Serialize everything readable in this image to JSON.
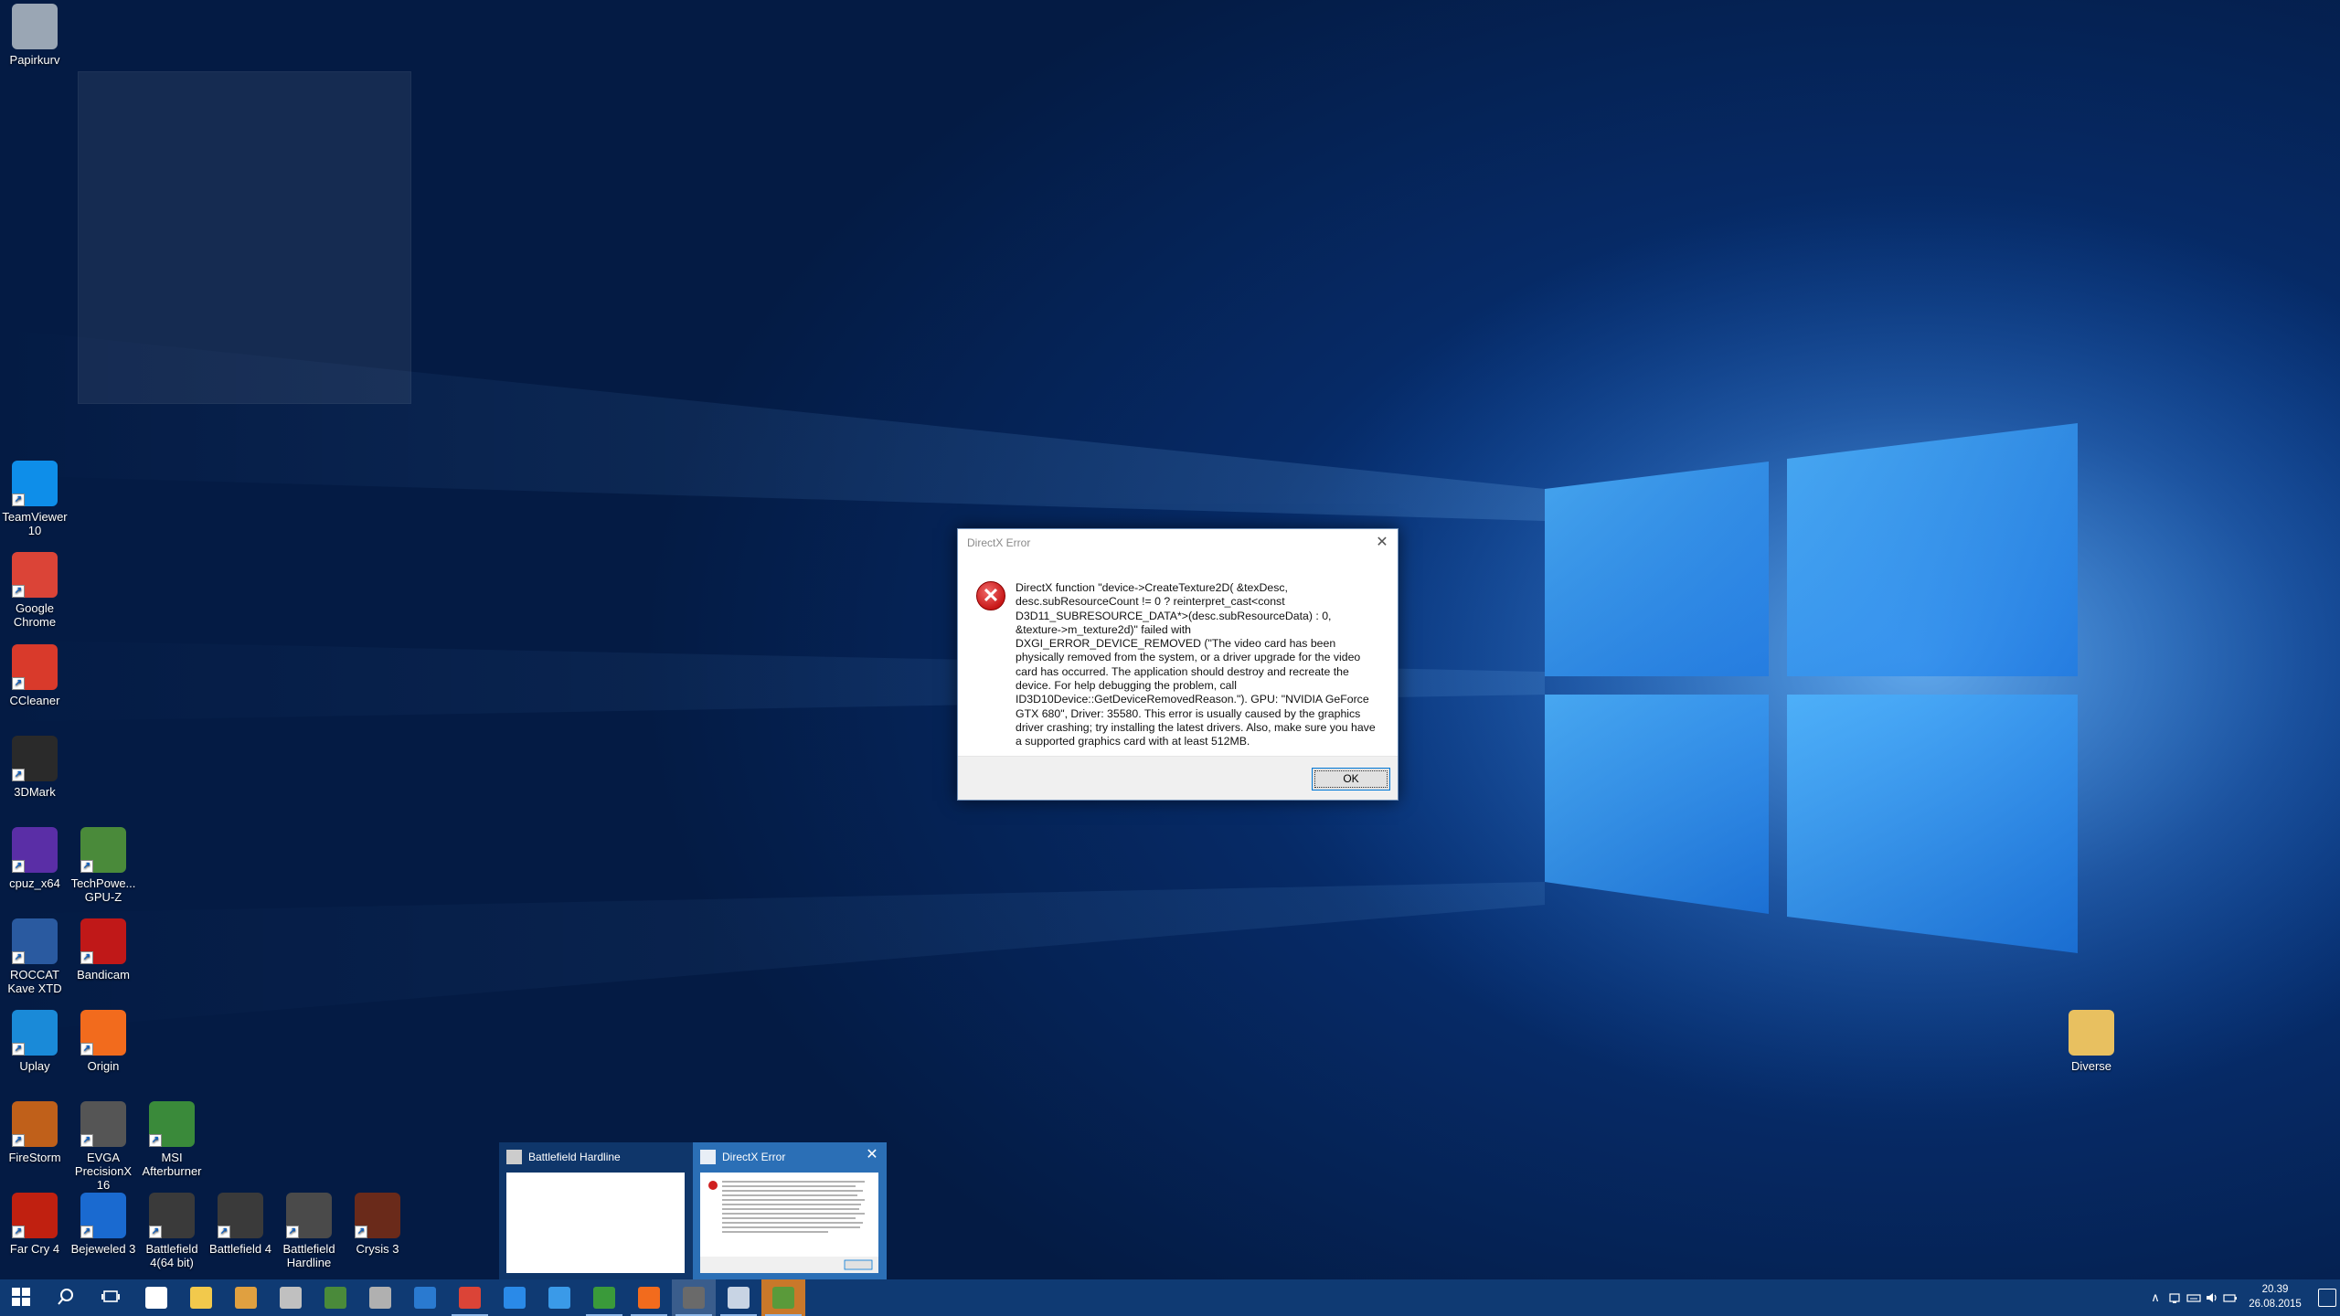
{
  "desktop_icons": [
    {
      "id": "recycle",
      "label": "Papirkurv",
      "icon": "recycle-bin-icon",
      "color": "#9aa6b4"
    },
    {
      "id": "teamviewer",
      "label": "TeamViewer 10",
      "icon": "teamviewer-icon",
      "color": "#0e8ee9"
    },
    {
      "id": "chrome",
      "label": "Google Chrome",
      "icon": "chrome-icon",
      "color": "#db4437"
    },
    {
      "id": "ccleaner",
      "label": "CCleaner",
      "icon": "ccleaner-icon",
      "color": "#d93a2b"
    },
    {
      "id": "3dmark",
      "label": "3DMark",
      "icon": "3dmark-icon",
      "color": "#2a2a2a"
    },
    {
      "id": "cpuz",
      "label": "cpuz_x64",
      "icon": "cpuz-icon",
      "color": "#5a2ea6"
    },
    {
      "id": "gpuz",
      "label": "TechPowe... GPU-Z",
      "icon": "gpuz-icon",
      "color": "#4a8a3a"
    },
    {
      "id": "roccat",
      "label": "ROCCAT Kave XTD",
      "icon": "roccat-icon",
      "color": "#2a5aa0"
    },
    {
      "id": "bandicam",
      "label": "Bandicam",
      "icon": "bandicam-icon",
      "color": "#c01818"
    },
    {
      "id": "uplay",
      "label": "Uplay",
      "icon": "uplay-icon",
      "color": "#1a8ad8"
    },
    {
      "id": "origin",
      "label": "Origin",
      "icon": "origin-icon",
      "color": "#f26b1d"
    },
    {
      "id": "firestorm",
      "label": "FireStorm",
      "icon": "firestorm-icon",
      "color": "#c0601a"
    },
    {
      "id": "evga",
      "label": "EVGA PrecisionX 16",
      "icon": "evga-icon",
      "color": "#555555"
    },
    {
      "id": "msi",
      "label": "MSI Afterburner",
      "icon": "msi-afterburner-icon",
      "color": "#3a8a3a"
    },
    {
      "id": "farcry4",
      "label": "Far Cry 4",
      "icon": "farcry4-icon",
      "color": "#c02010"
    },
    {
      "id": "bejeweled",
      "label": "Bejeweled 3",
      "icon": "bejeweled-icon",
      "color": "#1a6ad0"
    },
    {
      "id": "bf4x64",
      "label": "Battlefield 4(64 bit)",
      "icon": "battlefield4-icon",
      "color": "#3a3a3a"
    },
    {
      "id": "bf4",
      "label": "Battlefield 4",
      "icon": "battlefield4-icon",
      "color": "#3a3a3a"
    },
    {
      "id": "bfh",
      "label": "Battlefield Hardline",
      "icon": "battlefield-hardline-icon",
      "color": "#4a4a4a"
    },
    {
      "id": "crysis3",
      "label": "Crysis 3",
      "icon": "crysis3-icon",
      "color": "#6a2a1a"
    },
    {
      "id": "diverse",
      "label": "Diverse",
      "icon": "folder-icon",
      "color": "#e8c060"
    }
  ],
  "dialog": {
    "title": "DirectX Error",
    "message": "DirectX function \"device->CreateTexture2D( &texDesc, desc.subResourceCount != 0 ? reinterpret_cast<const D3D11_SUBRESOURCE_DATA*>(desc.subResourceData) : 0, &texture->m_texture2d)\" failed with DXGI_ERROR_DEVICE_REMOVED (\"The video card has been physically removed from the system, or a driver upgrade for the video card has occurred. The application should destroy and recreate the device. For help debugging the problem, call ID3D10Device::GetDeviceRemovedReason.\"). GPU: \"NVIDIA GeForce GTX 680\", Driver: 35580. This error is usually caused by the graphics driver crashing; try installing the latest drivers. Also, make sure you have a supported graphics card with at least 512MB.",
    "ok_label": "OK",
    "close_glyph": "✕",
    "icon_glyph": "✕"
  },
  "thumbnails": [
    {
      "title": "Battlefield Hardline",
      "active": false
    },
    {
      "title": "DirectX Error",
      "active": true,
      "close_glyph": "✕"
    }
  ],
  "taskbar": {
    "items": [
      {
        "id": "start",
        "icon": "windows-start-icon",
        "color": "#ffffff"
      },
      {
        "id": "search",
        "icon": "search-icon",
        "color": "#ffffff"
      },
      {
        "id": "taskview",
        "icon": "task-view-icon",
        "color": "#ffffff"
      },
      {
        "id": "store",
        "icon": "store-icon",
        "color": "#ffffff"
      },
      {
        "id": "explorer",
        "icon": "file-explorer-icon",
        "color": "#f2c94c"
      },
      {
        "id": "media",
        "icon": "media-player-icon",
        "color": "#e0a040"
      },
      {
        "id": "tool1",
        "icon": "satellite-icon",
        "color": "#c0c0c0"
      },
      {
        "id": "gpuz",
        "icon": "gpuz-icon",
        "color": "#4a8a3a"
      },
      {
        "id": "tool2",
        "icon": "hardware-icon",
        "color": "#b0b0b0"
      },
      {
        "id": "outlook",
        "icon": "mail-icon",
        "color": "#2a7ad0"
      },
      {
        "id": "chrome",
        "icon": "chrome-icon",
        "color": "#db4437"
      },
      {
        "id": "edge",
        "icon": "edge-icon",
        "color": "#2a8ae8"
      },
      {
        "id": "ie",
        "icon": "internet-explorer-icon",
        "color": "#3a9ae8"
      },
      {
        "id": "xbox",
        "icon": "xbox-icon",
        "color": "#3a9a3a"
      },
      {
        "id": "origin",
        "icon": "origin-icon",
        "color": "#f26b1d"
      },
      {
        "id": "bfh",
        "icon": "battlefield-hardline-icon",
        "color": "#6a6a6a"
      },
      {
        "id": "dxerror",
        "icon": "dialog-window-icon",
        "color": "#c8d4e4"
      },
      {
        "id": "paint",
        "icon": "paint-icon",
        "color": "#5a9a3a"
      }
    ],
    "clock_time": "20.39",
    "clock_date": "26.08.2015",
    "tray_up_glyph": "∧",
    "tray_icons": [
      "network-icon",
      "volume-icon",
      "keyboard-icon",
      "battery-icon"
    ]
  }
}
